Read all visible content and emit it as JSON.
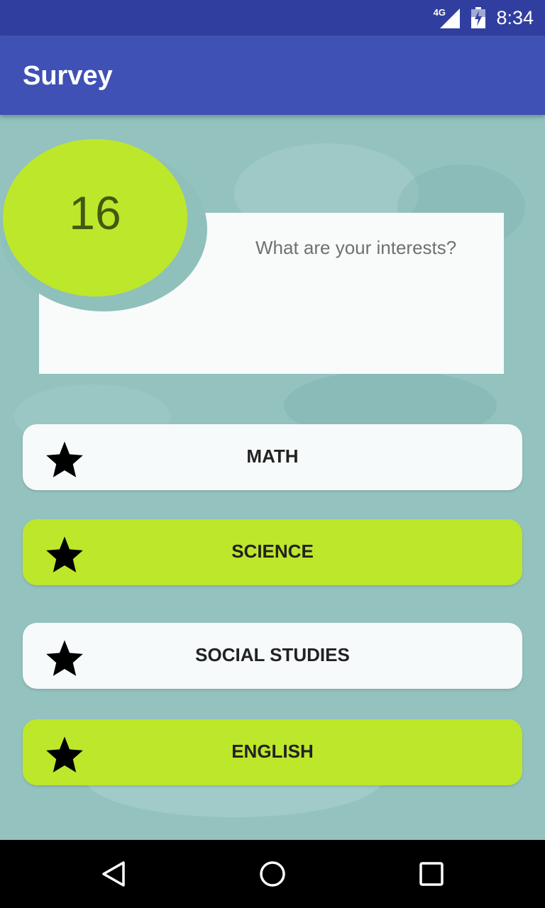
{
  "status_bar": {
    "network": "4G",
    "time": "8:34",
    "icons": [
      "signal-icon",
      "battery-icon"
    ]
  },
  "app_bar": {
    "title": "Survey",
    "color": "#3f51b5"
  },
  "question": {
    "counter": "16",
    "text": "What are your interests?"
  },
  "options": [
    {
      "label": "MATH",
      "icon": "star-icon",
      "style": "white"
    },
    {
      "label": "SCIENCE",
      "icon": "star-icon",
      "style": "green"
    },
    {
      "label": "SOCIAL STUDIES",
      "icon": "star-icon",
      "style": "white"
    },
    {
      "label": "ENGLISH",
      "icon": "star-icon",
      "style": "green"
    }
  ],
  "colors": {
    "accent_green": "#bde72b",
    "background_teal": "#93c2bf",
    "status_bar": "#303f9f"
  },
  "nav_bar": {
    "icons": [
      "back-icon",
      "home-icon",
      "recents-icon"
    ]
  }
}
